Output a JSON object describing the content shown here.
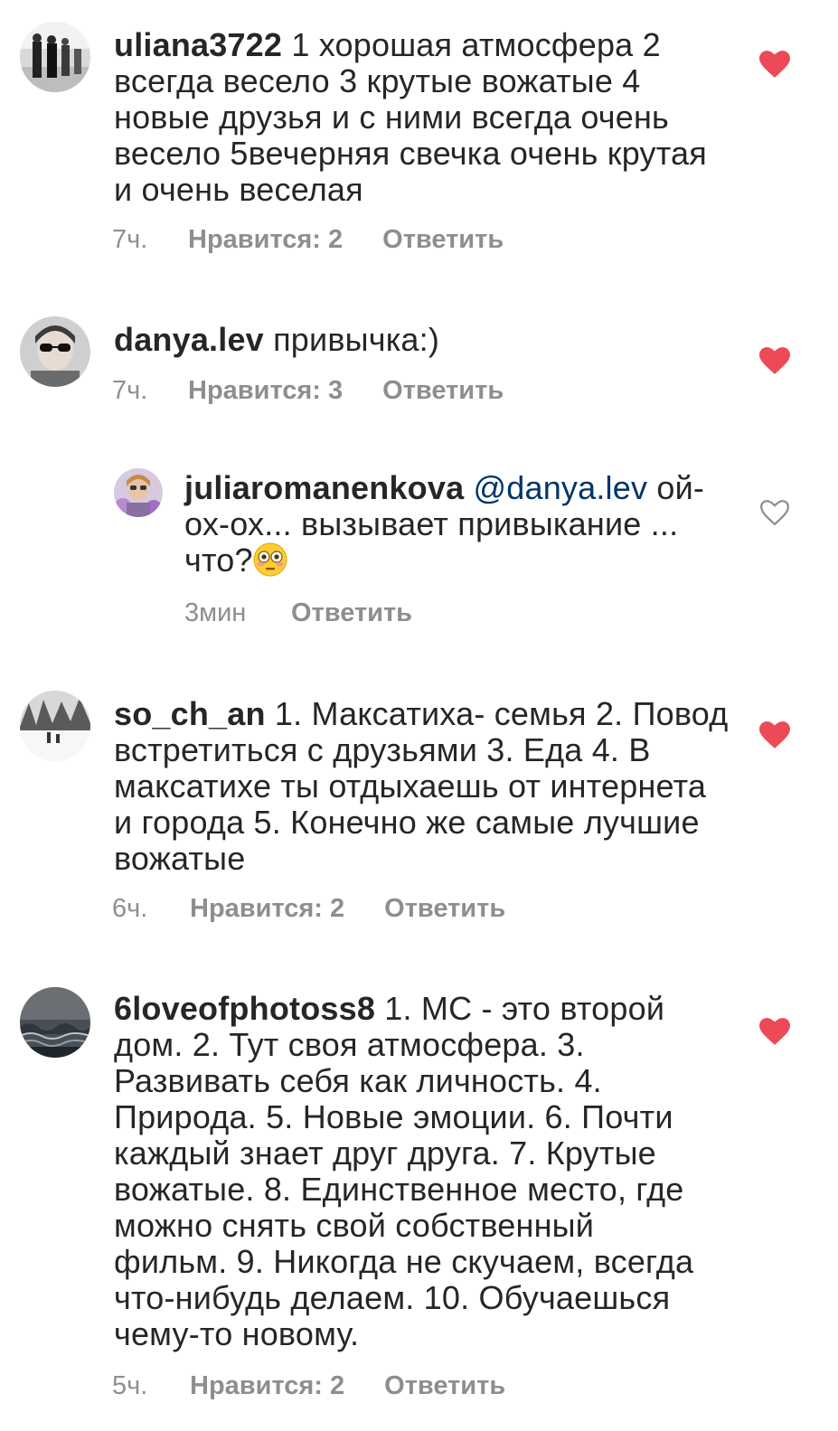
{
  "comments": [
    {
      "username": "uliana3722",
      "lines": [
        " 1 хорошая атмосфера 2",
        "всегда весело 3 крутые вожатые 4",
        "новые  друзья и с ними всегда очень",
        "весело 5вечерняя свечка очень крутая",
        "и очень веселая"
      ],
      "time": "7ч.",
      "likes": "Нравится: 2",
      "reply": "Ответить",
      "liked": true,
      "avatar": "people-street-photo"
    },
    {
      "username": "danya.lev",
      "lines": [
        " привычка:)"
      ],
      "time": "7ч.",
      "likes": "Нравится: 3",
      "reply": "Ответить",
      "liked": true,
      "avatar": "person-sunglasses-photo"
    },
    {
      "username": "juliaromanenkova",
      "mention": "@danya.lev",
      "lines_first_suffix": " ой-",
      "lines": [
        "ох-ох... вызывает привыкание ...",
        "что?"
      ],
      "emoji": "flushed-face",
      "time": "3мин",
      "reply": "Ответить",
      "liked": false,
      "avatar": "woman-flowers-photo"
    },
    {
      "username": "so_ch_an",
      "lines": [
        " 1. Максатиха- семья 2. Повод",
        "встретиться с друзьями 3. Еда 4. В",
        "максатихе ты отдыхаешь от интернета",
        "и города 5. Конечно же самые лучшие",
        "вожатые"
      ],
      "time": "6ч.",
      "likes": "Нравится: 2",
      "reply": "Ответить",
      "liked": true,
      "avatar": "snow-park-photo"
    },
    {
      "username": "6loveofphotoss8",
      "lines": [
        " 1. МС - это второй",
        "дом. 2. Тут своя атмосфера. 3.",
        "Развивать себя как личность. 4.",
        "Природа. 5. Новые эмоции. 6. Почти",
        "каждый знает друг друга. 7. Крутые",
        "вожатые. 8. Единственное место, где",
        "можно снять свой собственный",
        "фильм. 9. Никогда не скучаем, всегда",
        "что-нибудь делаем. 10. Обучаешься",
        "чему-то новому."
      ],
      "time": "5ч.",
      "likes": "Нравится: 2",
      "reply": "Ответить",
      "liked": true,
      "avatar": "stormy-sea-photo"
    }
  ],
  "colors": {
    "heart_liked": "#ed4956",
    "heart_empty": "#8e8e8e",
    "meta": "#8e8e8e",
    "text": "#262626",
    "mention": "#003569"
  }
}
